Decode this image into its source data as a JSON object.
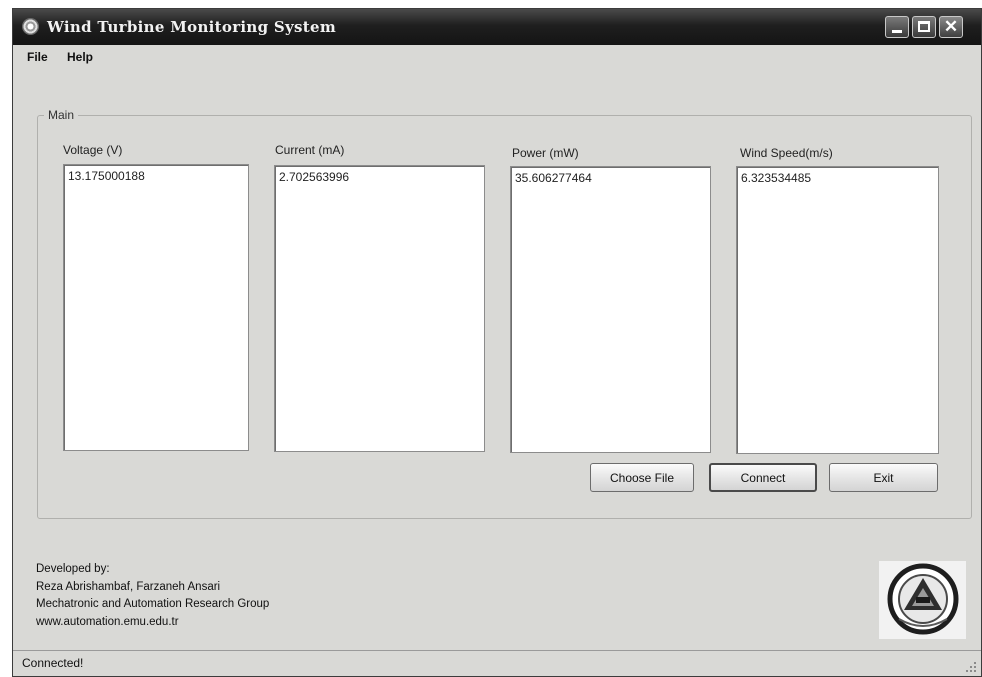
{
  "window": {
    "title": "Wind Turbine Monitoring System"
  },
  "menu": {
    "items": [
      "File",
      "Help"
    ]
  },
  "main": {
    "group_title": "Main",
    "fields": [
      {
        "label": "Voltage (V)",
        "value": "13.175000188"
      },
      {
        "label": "Current (mA)",
        "value": "2.702563996"
      },
      {
        "label": "Power (mW)",
        "value": "35.606277464"
      },
      {
        "label": "Wind Speed(m/s)",
        "value": "6.323534485"
      }
    ],
    "buttons": {
      "choose_file": "Choose File",
      "connect": "Connect",
      "exit": "Exit"
    }
  },
  "credits": {
    "heading": "Developed by:",
    "authors": "Reza Abrishambaf, Farzaneh Ansari",
    "group": "Mechatronic and Automation Research Group",
    "website": "www.automation.emu.edu.tr"
  },
  "logo": {
    "icon": "emu-mechatronics-logo"
  },
  "status": {
    "text": "Connected!"
  }
}
